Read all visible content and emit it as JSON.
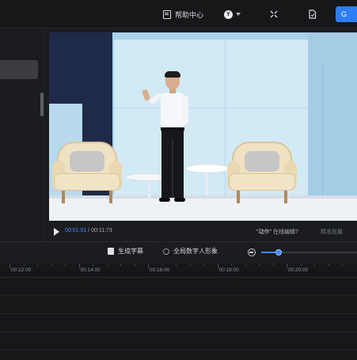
{
  "topbar": {
    "help_label": "帮助中心",
    "avatar_letter": "Y",
    "primary_button_label": "G"
  },
  "player": {
    "current_time": "00:01:01",
    "total_time": "/ 00:11:73",
    "action_tag": "\"动作\"",
    "action_hint": "在线编辑?",
    "right_info": "精准批量"
  },
  "toolbar": {
    "generate_subtitles_label": "生成字幕",
    "global_avatar_label": "全局数字人形象",
    "zoom_level": 0.18
  },
  "timeline": {
    "ticks": [
      "00:12:00",
      "00:14:00",
      "00:16:00",
      "00:18:00",
      "00:20:00"
    ]
  },
  "colors": {
    "accent": "#3f8cff",
    "primary_button": "#2f7df6",
    "background": "#1b1c1f"
  }
}
